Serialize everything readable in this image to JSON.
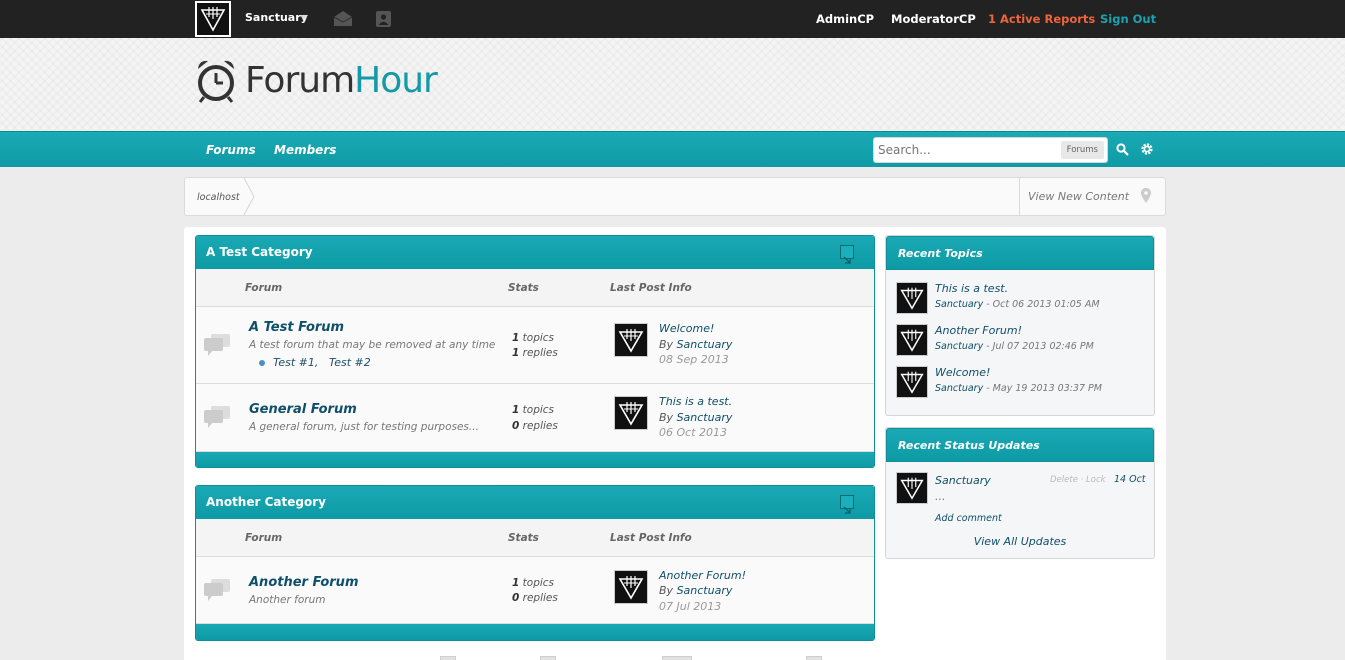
{
  "userbar": {
    "username": "Sanctuary",
    "links": {
      "admin": "AdminCP",
      "moderator": "ModeratorCP",
      "reports": "1 Active Reports",
      "signout": "Sign Out"
    }
  },
  "header": {
    "logo_part1": "Forum",
    "logo_part2": "Hour"
  },
  "nav": {
    "forums": "Forums",
    "members": "Members",
    "search_placeholder": "Search...",
    "search_scope": "Forums"
  },
  "breadcrumb": {
    "home": "localhost",
    "view_new": "View New Content"
  },
  "columns": {
    "forum": "Forum",
    "stats": "Stats",
    "last_post": "Last Post Info"
  },
  "categories": [
    {
      "title": "A Test Category",
      "forums": [
        {
          "title": "A Test Forum",
          "description": "A test forum that may be removed at any time",
          "subforums": [
            "Test #1,",
            "Test #2"
          ],
          "topics": "1",
          "replies": "1",
          "topics_label": "topics",
          "replies_label": "replies",
          "last_post_title": "Welcome!",
          "last_post_by": "By",
          "last_post_user": "Sanctuary",
          "last_post_date": "08 Sep 2013"
        },
        {
          "title": "General Forum",
          "description": "A general forum, just for testing purposes...",
          "topics": "1",
          "replies": "0",
          "topics_label": "topics",
          "replies_label": "replies",
          "last_post_title": "This is a test.",
          "last_post_by": "By",
          "last_post_user": "Sanctuary",
          "last_post_date": "06 Oct 2013"
        }
      ]
    },
    {
      "title": "Another Category",
      "forums": [
        {
          "title": "Another Forum",
          "description": "Another forum",
          "topics": "1",
          "replies": "0",
          "topics_label": "topics",
          "replies_label": "replies",
          "last_post_title": "Another Forum!",
          "last_post_by": "By",
          "last_post_user": "Sanctuary",
          "last_post_date": "07 Jul 2013"
        }
      ]
    }
  ],
  "sidebar": {
    "recent_topics": {
      "title": "Recent Topics",
      "items": [
        {
          "title": "This is a test.",
          "user": "Sanctuary",
          "date": "- Oct 06 2013 01:05 AM"
        },
        {
          "title": "Another Forum!",
          "user": "Sanctuary",
          "date": "- Jul 07 2013 02:46 PM"
        },
        {
          "title": "Welcome!",
          "user": "Sanctuary",
          "date": "- May 19 2013 03:37 PM"
        }
      ]
    },
    "status_updates": {
      "title": "Recent Status Updates",
      "user": "Sanctuary",
      "text": "...",
      "actions": "Delete · Lock",
      "date": "14 Oct",
      "add_comment": "Add comment",
      "view_all": "View All Updates"
    }
  },
  "colors": {
    "accent": "#139aa6",
    "topbar": "#222222",
    "reports": "#f0643c"
  }
}
